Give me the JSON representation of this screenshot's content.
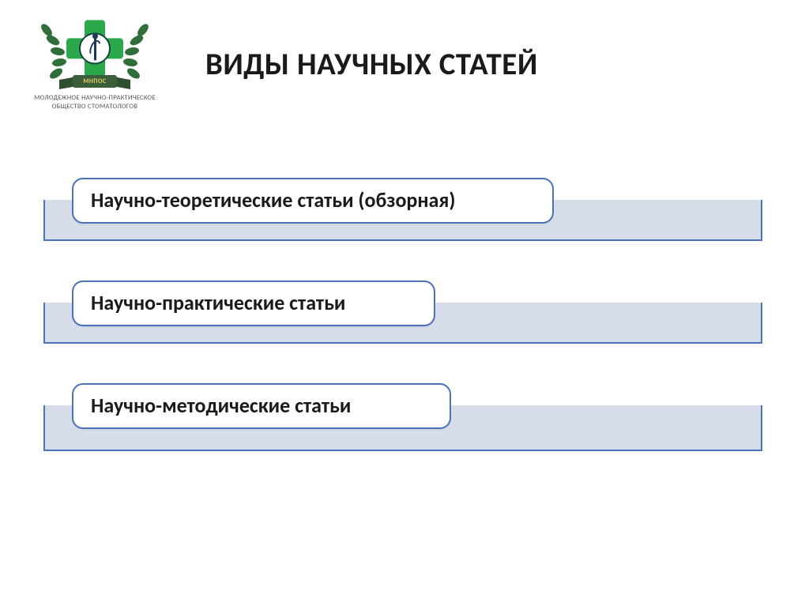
{
  "logo": {
    "ribbon_text": "МНПОС",
    "line1": "МОЛОДЕЖНОЕ НАУЧНО-ПРАКТИЧЕСКОЕ",
    "line2": "ОБЩЕСТВО СТОМАТОЛОГОВ"
  },
  "title": "ВИДЫ НАУЧНЫХ СТАТЕЙ",
  "items": [
    {
      "label": "Научно-теоретические статьи (обзорная)"
    },
    {
      "label": "Научно-практические статьи"
    },
    {
      "label": "Научно-методические статьи"
    }
  ]
}
